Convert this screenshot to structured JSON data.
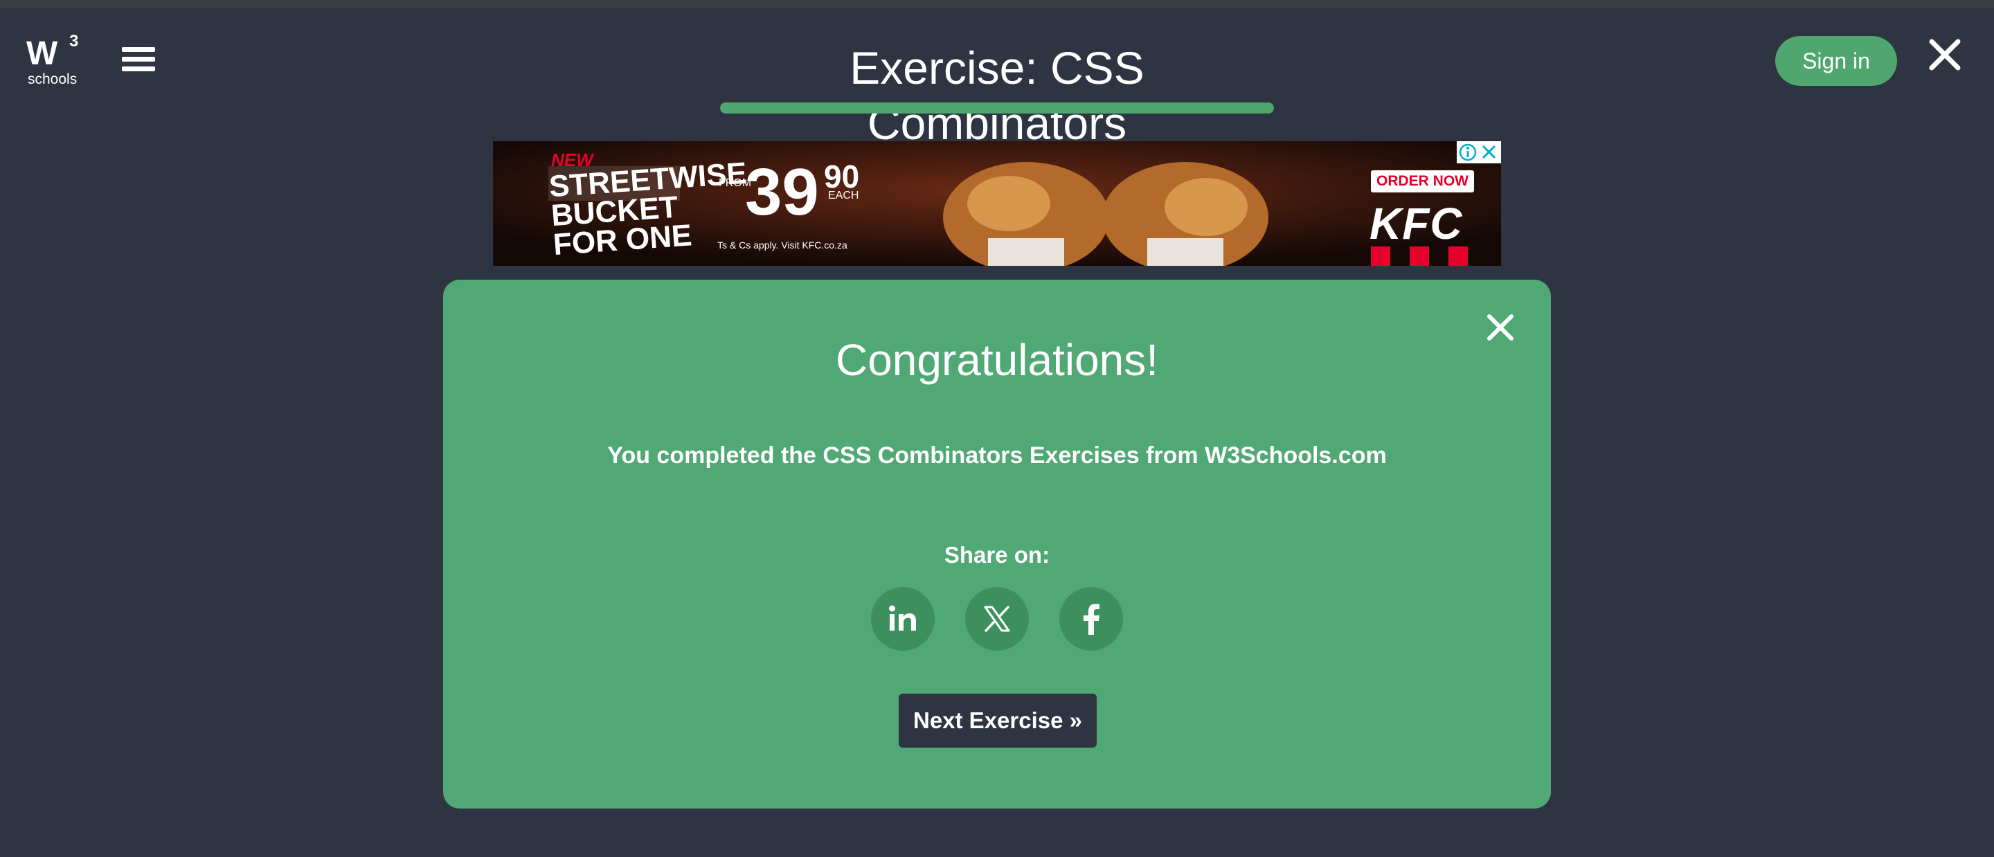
{
  "header": {
    "logo_text": "W",
    "logo_sup": "3",
    "logo_sub": "schools",
    "title": "Exercise: CSS Combinators",
    "progress_percent": 100,
    "signin_label": "Sign in"
  },
  "ad": {
    "new_tag": "NEW",
    "headline": "STREETWISE BUCKET FOR ONE",
    "from": "FROM",
    "price": "39",
    "cents": "90",
    "each": "EACH",
    "terms": "Ts & Cs apply. Visit KFC.co.za",
    "cta": "ORDER NOW",
    "brand": "KFC"
  },
  "modal": {
    "title": "Congratulations!",
    "message": "You completed the CSS Combinators Exercises from W3Schools.com",
    "share_label": "Share on:",
    "share_items": [
      "linkedin-icon",
      "x-icon",
      "facebook-icon"
    ],
    "next_label": "Next Exercise »"
  },
  "colors": {
    "background": "#2e3441",
    "accent": "#4fa66f",
    "modal": "#50a874"
  }
}
